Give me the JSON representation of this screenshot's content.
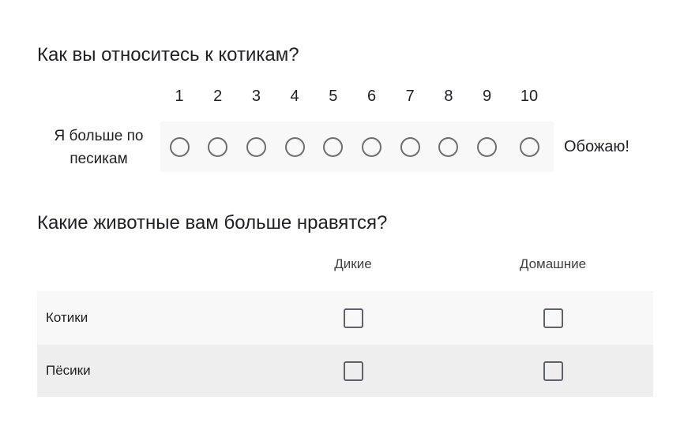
{
  "linear_scale": {
    "title": "Как вы относитесь к котикам?",
    "numbers": [
      "1",
      "2",
      "3",
      "4",
      "5",
      "6",
      "7",
      "8",
      "9",
      "10"
    ],
    "min_label": "Я больше по песикам",
    "max_label": "Обожаю!",
    "selected": null
  },
  "grid": {
    "title": "Какие животные вам больше нравятся?",
    "columns": [
      "Дикие",
      "Домашние"
    ],
    "rows": [
      {
        "label": "Котики",
        "checked": [
          false,
          false
        ]
      },
      {
        "label": "Пёсики",
        "checked": [
          false,
          false
        ]
      }
    ]
  },
  "colors": {
    "text": "#202124",
    "radio_border": "#6f6f6f",
    "checkbox_border": "#5f6368",
    "row_light": "#f8f8f8",
    "row_dark": "#eeeeee"
  }
}
